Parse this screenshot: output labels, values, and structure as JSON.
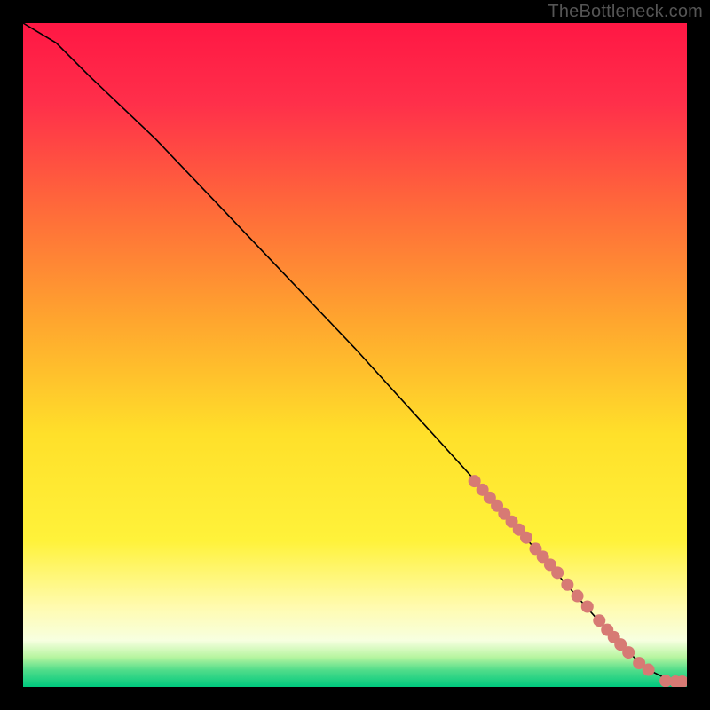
{
  "watermark": "TheBottleneck.com",
  "colors": {
    "frame_bg": "#000000",
    "gradient_stops": [
      {
        "offset": 0.0,
        "color": "#ff1744"
      },
      {
        "offset": 0.12,
        "color": "#ff2f4a"
      },
      {
        "offset": 0.28,
        "color": "#ff6a3a"
      },
      {
        "offset": 0.45,
        "color": "#ffa62e"
      },
      {
        "offset": 0.62,
        "color": "#ffe02a"
      },
      {
        "offset": 0.78,
        "color": "#fff23a"
      },
      {
        "offset": 0.88,
        "color": "#fffbb0"
      },
      {
        "offset": 0.93,
        "color": "#f7ffe0"
      },
      {
        "offset": 0.955,
        "color": "#b7f5a0"
      },
      {
        "offset": 0.975,
        "color": "#4fdc8a"
      },
      {
        "offset": 1.0,
        "color": "#00c97e"
      }
    ],
    "curve_stroke": "#000000",
    "marker_fill": "#d77a74",
    "marker_stroke": "#d77a74"
  },
  "chart_data": {
    "type": "line",
    "title": "",
    "xlabel": "",
    "ylabel": "",
    "xlim": [
      0,
      100
    ],
    "ylim": [
      0,
      100
    ],
    "grid": false,
    "series": [
      {
        "name": "curve",
        "x": [
          0,
          5,
          10,
          20,
          30,
          40,
          50,
          60,
          70,
          80,
          88,
          92,
          95,
          97,
          99,
          100
        ],
        "y": [
          100,
          97,
          92,
          82.5,
          72,
          61.5,
          51,
          40,
          29,
          17.5,
          8.5,
          4.5,
          2.2,
          1.2,
          0.8,
          0.8
        ]
      }
    ],
    "markers": [
      {
        "x": 68.0,
        "y": 31.0
      },
      {
        "x": 69.2,
        "y": 29.7
      },
      {
        "x": 70.3,
        "y": 28.5
      },
      {
        "x": 71.4,
        "y": 27.3
      },
      {
        "x": 72.5,
        "y": 26.1
      },
      {
        "x": 73.6,
        "y": 24.9
      },
      {
        "x": 74.7,
        "y": 23.7
      },
      {
        "x": 75.8,
        "y": 22.5
      },
      {
        "x": 77.2,
        "y": 20.8
      },
      {
        "x": 78.3,
        "y": 19.6
      },
      {
        "x": 79.4,
        "y": 18.4
      },
      {
        "x": 80.5,
        "y": 17.2
      },
      {
        "x": 82.0,
        "y": 15.4
      },
      {
        "x": 83.5,
        "y": 13.7
      },
      {
        "x": 85.0,
        "y": 12.1
      },
      {
        "x": 86.8,
        "y": 10.0
      },
      {
        "x": 88.0,
        "y": 8.6
      },
      {
        "x": 89.0,
        "y": 7.5
      },
      {
        "x": 90.0,
        "y": 6.4
      },
      {
        "x": 91.2,
        "y": 5.2
      },
      {
        "x": 92.8,
        "y": 3.6
      },
      {
        "x": 94.2,
        "y": 2.6
      },
      {
        "x": 96.8,
        "y": 0.9
      },
      {
        "x": 98.3,
        "y": 0.8
      },
      {
        "x": 99.3,
        "y": 0.8
      }
    ],
    "marker_radius_px": 6.5
  }
}
